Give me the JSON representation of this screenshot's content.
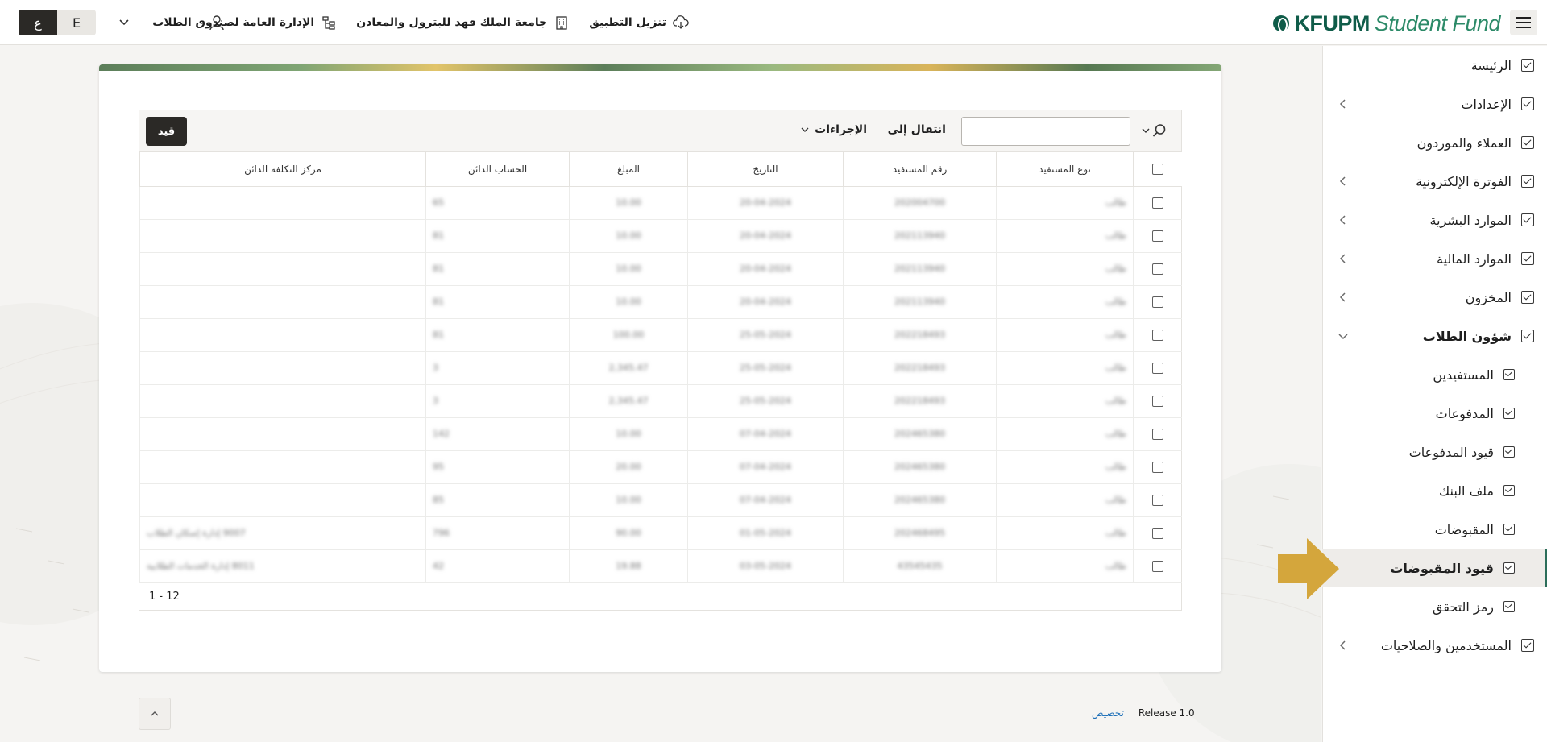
{
  "header": {
    "logo_primary": "KFUPM",
    "logo_secondary": "Student Fund",
    "download_app": "تنزيل التطبيق",
    "university": "جامعة الملك فهد للبترول والمعادن",
    "department": "الإدارة العامة لصندوق الطلاب",
    "lang_arabic": "ع",
    "lang_english": "E"
  },
  "sidebar": {
    "items": [
      {
        "label": "الرئيسة",
        "has_children": false
      },
      {
        "label": "الإعدادات",
        "has_children": true
      },
      {
        "label": "العملاء والموردون",
        "has_children": false
      },
      {
        "label": "الفوترة الإلكترونية",
        "has_children": true
      },
      {
        "label": "الموارد البشرية",
        "has_children": true
      },
      {
        "label": "الموارد المالية",
        "has_children": true
      },
      {
        "label": "المخزون",
        "has_children": true
      },
      {
        "label": "شؤون الطلاب",
        "has_children": true,
        "expanded": true
      },
      {
        "label": "المستفيدين",
        "sub": true
      },
      {
        "label": "المدفوعات",
        "sub": true
      },
      {
        "label": "قيود المدفوعات",
        "sub": true
      },
      {
        "label": "ملف البنك",
        "sub": true
      },
      {
        "label": "المقبوضات",
        "sub": true
      },
      {
        "label": "قيود المقبوضات",
        "sub": true,
        "current": true
      },
      {
        "label": "رمز التحقق",
        "sub": true
      },
      {
        "label": "المستخدمين والصلاحيات",
        "has_children": true
      }
    ]
  },
  "report": {
    "goto_label": "انتقال إلى",
    "actions_label": "الإجراءات",
    "post_button": "قيد",
    "search_value": "",
    "columns": [
      "نوع المستفيد",
      "رقم المستفيد",
      "التاريخ",
      "المبلغ",
      "الحساب الدائن",
      "مركز التكلفة الدائن"
    ],
    "rows": [
      [
        "طالب",
        "202004700",
        "20-04-2024",
        "10.00",
        "65",
        ""
      ],
      [
        "طالب",
        "202113940",
        "20-04-2024",
        "10.00",
        "81",
        ""
      ],
      [
        "طالب",
        "202113940",
        "20-04-2024",
        "10.00",
        "81",
        ""
      ],
      [
        "طالب",
        "202113940",
        "20-04-2024",
        "10.00",
        "81",
        ""
      ],
      [
        "طالب",
        "202218493",
        "25-05-2024",
        "100.00",
        "81",
        ""
      ],
      [
        "طالب",
        "202218493",
        "25-05-2024",
        "2,345.47",
        "3",
        ""
      ],
      [
        "طالب",
        "202218493",
        "25-05-2024",
        "2,345.47",
        "3",
        ""
      ],
      [
        "طالب",
        "202465380",
        "07-04-2024",
        "10.00",
        "142",
        ""
      ],
      [
        "طالب",
        "202465380",
        "07-04-2024",
        "20.00",
        "95",
        ""
      ],
      [
        "طالب",
        "202465380",
        "07-04-2024",
        "10.00",
        "85",
        ""
      ],
      [
        "طالب",
        "202468495",
        "01-05-2024",
        "90.00",
        "796",
        "9007 إدارة إسكان الطلاب"
      ],
      [
        "طالب",
        "43545435",
        "03-05-2024",
        "19.88",
        "42",
        "8011 إدارة الخدمات الطلابية"
      ]
    ],
    "pagination": "1 - 12"
  },
  "footer": {
    "release": "Release 1.0",
    "customize": "تخصيص"
  },
  "colors": {
    "brand": "#0f5c49",
    "brand_secondary": "#2c8a68",
    "dark_button": "#2b2926",
    "pointer_arrow": "#d4a63c",
    "link": "#1d6fb8"
  },
  "icons": {
    "menu": "hamburger-icon",
    "download": "cloud-download-icon",
    "university": "building-icon",
    "department": "org-chart-icon",
    "user": "user-icon",
    "search": "search-icon",
    "scroll_top": "chevron-up-icon"
  }
}
